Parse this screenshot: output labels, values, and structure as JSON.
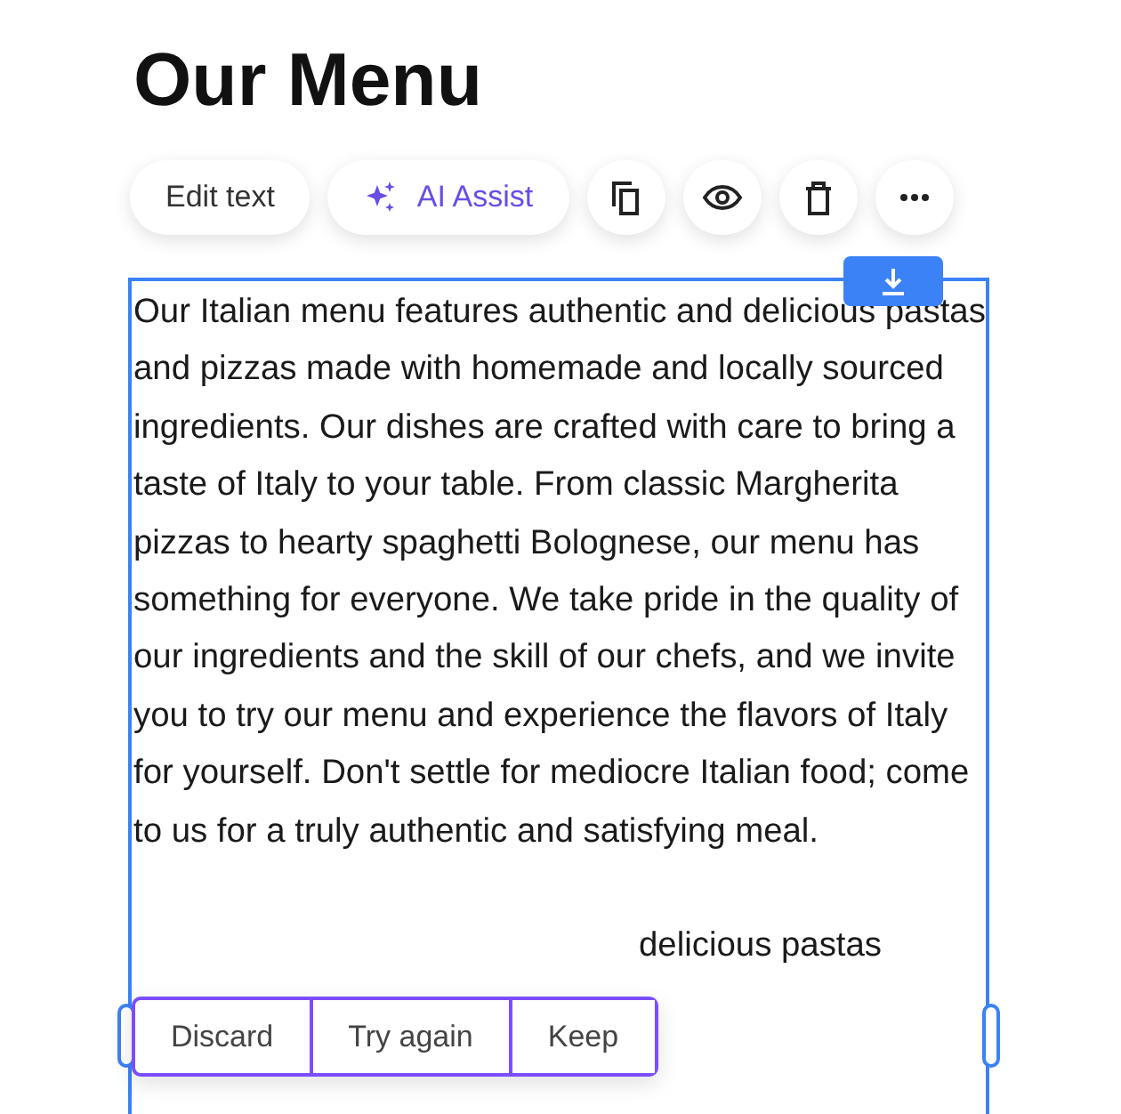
{
  "heading": "Our Menu",
  "toolbar": [
    {
      "kind": "text",
      "label": "Edit text"
    },
    {
      "kind": "ai",
      "label": "AI Assist"
    },
    {
      "kind": "copy"
    },
    {
      "kind": "preview"
    },
    {
      "kind": "delete"
    },
    {
      "kind": "more"
    }
  ],
  "paragraphs": [
    "Our Italian menu features authentic and delicious pastas and pizzas made with homemade and locally sourced ingredients. Our dishes are crafted with care to bring a taste of Italy to your table. From classic Margherita pizzas to hearty spaghetti Bolognese, our menu has something for everyone. We take pride in the quality of our ingredients and the skill of our chefs, and we invite you to try our menu and experience the flavors of Italy for yourself. Don't settle for mediocre Italian food; come to us for a truly authentic and satisfying meal.",
    "delicious pastas"
  ],
  "ai_actions": [
    "Discard",
    "Try again",
    "Keep"
  ]
}
